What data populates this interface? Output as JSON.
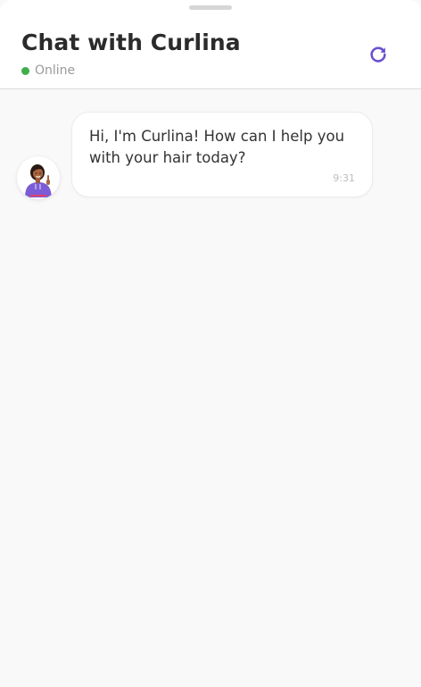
{
  "header": {
    "title": "Chat with Curlina",
    "status_text": "Online",
    "status_color": "#3fae49",
    "refresh_icon": "refresh-icon",
    "accent_color": "#6a4fd1"
  },
  "messages": [
    {
      "sender": "bot",
      "avatar_icon": "assistant-avatar",
      "text": "Hi, I'm Curlina! How can I help you with your hair today?",
      "time": "9:31"
    }
  ]
}
